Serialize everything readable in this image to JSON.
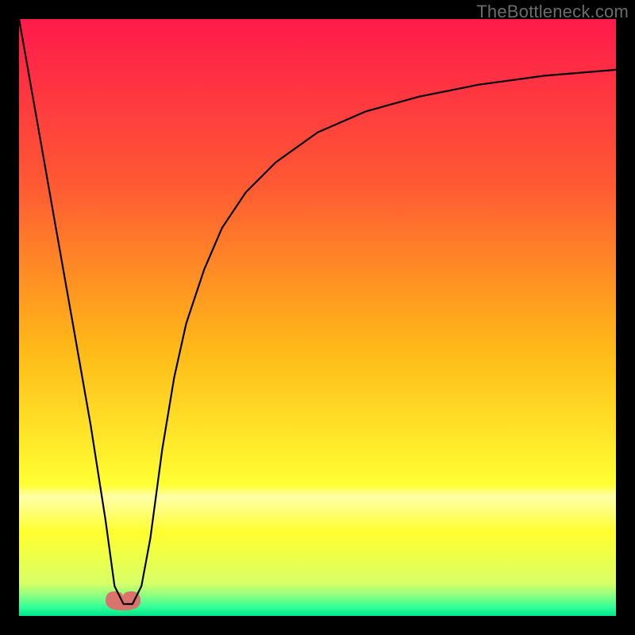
{
  "watermark": "TheBottleneck.com",
  "chart_data": {
    "type": "line",
    "title": "",
    "xlabel": "",
    "ylabel": "",
    "xlim": [
      0,
      100
    ],
    "ylim": [
      0,
      100
    ],
    "grid": false,
    "legend": false,
    "background_gradient": {
      "direction": "vertical",
      "stops": [
        {
          "pos": 0.0,
          "color": "#ff1a4b"
        },
        {
          "pos": 0.28,
          "color": "#ff5a33"
        },
        {
          "pos": 0.55,
          "color": "#ffb818"
        },
        {
          "pos": 0.78,
          "color": "#ffff33"
        },
        {
          "pos": 0.8,
          "color": "#ffffaa"
        },
        {
          "pos": 0.86,
          "color": "#ffff2e"
        },
        {
          "pos": 0.945,
          "color": "#d9ff66"
        },
        {
          "pos": 0.965,
          "color": "#8fff80"
        },
        {
          "pos": 0.985,
          "color": "#33ff99"
        },
        {
          "pos": 1.0,
          "color": "#00e68a"
        }
      ]
    },
    "series": [
      {
        "name": "bottleneck-curve",
        "color": "#000000",
        "x": [
          0,
          3,
          6,
          9,
          12,
          14.5,
          16,
          17.5,
          19,
          20.5,
          22,
          24,
          26,
          28,
          31,
          34,
          38,
          43,
          50,
          58,
          67,
          77,
          88,
          100
        ],
        "y": [
          100,
          83,
          66,
          49,
          32,
          16,
          5,
          2,
          2,
          5,
          13,
          28,
          40,
          49,
          58,
          65,
          71,
          76,
          81,
          84.5,
          87,
          89,
          90.5,
          91.5
        ]
      }
    ],
    "markers": [
      {
        "name": "trough-marker",
        "shape": "rounded-blob",
        "color": "#d9736b",
        "cx": 17.5,
        "cy": 2.7,
        "rx": 3.2,
        "ry": 1.6
      }
    ],
    "min_x": 17.5,
    "min_y": 2
  }
}
